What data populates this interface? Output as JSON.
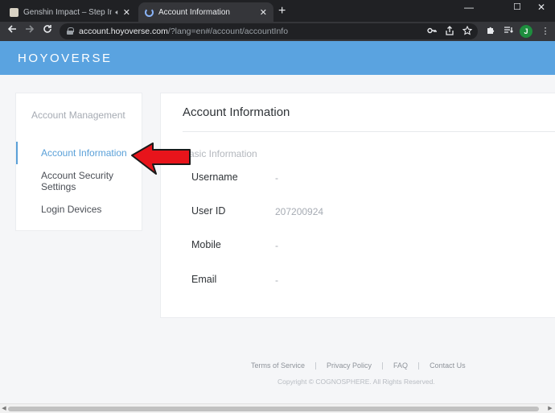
{
  "browser": {
    "tabs": [
      {
        "title": "Genshin Impact – Step Into a",
        "audio_icon": "speaker-icon",
        "close": "✕"
      },
      {
        "title": "Account Information",
        "close": "✕"
      }
    ],
    "new_tab": "+",
    "window_controls": {
      "minimize": "—",
      "maximize": "☐",
      "close": "✕"
    },
    "url_host": "account.hoyoverse.com",
    "url_path": "/?lang=en#/account/accountInfo",
    "profile_initial": "J"
  },
  "header": {
    "logo": "HOYOVERSE",
    "color": "#5aa3e0"
  },
  "sidebar": {
    "heading": "Account Management",
    "items": [
      {
        "label": "Account Information",
        "active": true
      },
      {
        "label": "Account Security Settings",
        "active": false
      },
      {
        "label": "Login Devices",
        "active": false
      }
    ],
    "accent": "#5aa0d8"
  },
  "main": {
    "title": "Account Information",
    "section": "Basic Information",
    "fields": [
      {
        "label": "Username",
        "value": "-"
      },
      {
        "label": "User ID",
        "value": "207200924"
      },
      {
        "label": "Mobile",
        "value": "-"
      },
      {
        "label": "Email",
        "value": "-"
      }
    ]
  },
  "footer": {
    "links": [
      "Terms of Service",
      "Privacy Policy",
      "FAQ",
      "Contact Us"
    ],
    "copyright": "Copyright © COGNOSPHERE. All Rights Reserved."
  },
  "annotation": {
    "arrow_color": "#e8141b",
    "icon": "red-arrow-icon"
  }
}
